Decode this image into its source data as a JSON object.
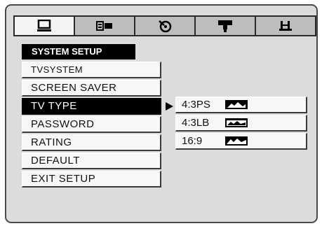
{
  "tabs": [
    {
      "icon": "monitor-icon"
    },
    {
      "icon": "speaker-icon"
    },
    {
      "icon": "dolby-icon"
    },
    {
      "icon": "video-icon"
    },
    {
      "icon": "preference-icon"
    }
  ],
  "section_title": "SYSTEM SETUP",
  "menu": {
    "items": [
      {
        "label": "TVSYSTEM"
      },
      {
        "label": "SCREEN SAVER"
      },
      {
        "label": "TV TYPE"
      },
      {
        "label": "PASSWORD"
      },
      {
        "label": "RATING"
      },
      {
        "label": "DEFAULT"
      },
      {
        "label": "EXIT SETUP"
      }
    ],
    "selected": "TV TYPE"
  },
  "submenu": {
    "items": [
      {
        "label": "4:3PS",
        "icon": "pan-scan-thumbnail-icon"
      },
      {
        "label": "4:3LB",
        "icon": "letterbox-thumbnail-icon"
      },
      {
        "label": "16:9",
        "icon": "widescreen-thumbnail-icon"
      }
    ]
  },
  "colors": {
    "panel": "#dcdcdc",
    "selected_bg": "#000000",
    "item_bg": "#f7f7f7"
  }
}
